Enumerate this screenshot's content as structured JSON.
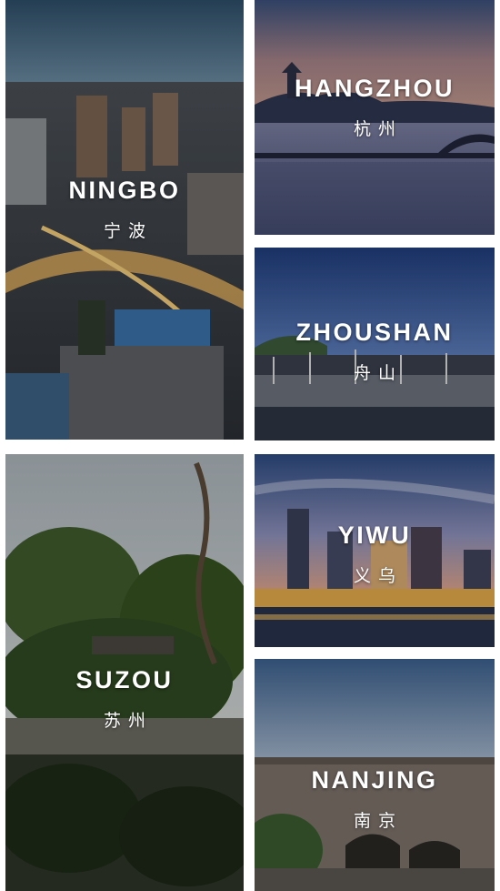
{
  "cities": {
    "ningbo": {
      "en": "NINGBO",
      "cn": "宁波"
    },
    "hangzhou": {
      "en": "HANGZHOU",
      "cn": "杭州"
    },
    "zhoushan": {
      "en": "ZHOUSHAN",
      "cn": "舟山"
    },
    "suzou": {
      "en": "SUZOU",
      "cn": "苏州"
    },
    "yiwu": {
      "en": "YIWU",
      "cn": "义乌"
    },
    "nanjing": {
      "en": "NANJING",
      "cn": "南京"
    }
  },
  "colors": {
    "background": "#ffffff",
    "text": "#ffffff"
  }
}
